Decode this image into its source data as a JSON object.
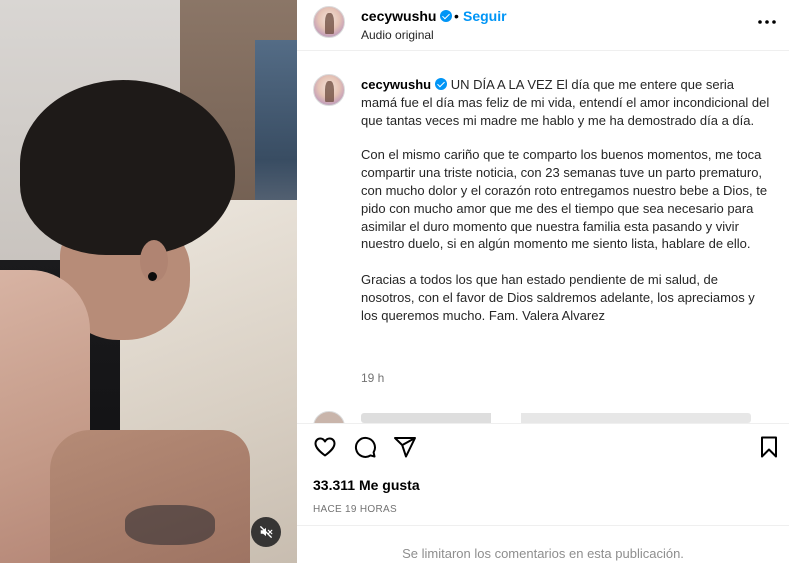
{
  "post": {
    "username": "cecywushu",
    "follow_label": "Seguir",
    "separator": "•",
    "audio": "Audio original",
    "more_icon": "more-horizontal-icon"
  },
  "caption": {
    "title": "UN DÍA A LA VEZ",
    "paragraphs": [
      "El día que me entere que seria mamá fue el día mas feliz de mi vida, entendí el amor incondicional del que tantas veces mi madre me hablo y me ha demostrado día a día.",
      "Con el mismo cariño que te comparto los buenos momentos, me toca compartir una triste noticia, con 23 semanas tuve un parto prematuro, con mucho dolor y el corazón roto entregamos nuestro bebe a Dios, te pido con mucho amor que me des el tiempo que sea necesario para asimilar el duro momento que nuestra familia esta pasando y vivir nuestro duelo, si en algún momento me siento lista, hablare de ello.",
      "Gracias a todos los que han estado pendiente de mi salud, de nosotros, con el favor de Dios saldremos adelante, los apreciamos y los queremos mucho. Fam. Valera Alvarez"
    ],
    "timestamp": "19 h"
  },
  "actions": {
    "like_icon": "heart-icon",
    "comment_icon": "comment-icon",
    "share_icon": "share-icon",
    "save_icon": "bookmark-icon"
  },
  "stats": {
    "likes": "33.311 Me gusta",
    "time_ago": "HACE 19 HORAS"
  },
  "footer": {
    "comments_disabled": "Se limitaron los comentarios en esta publicación."
  },
  "media": {
    "mute_icon": "speaker-muted-icon"
  },
  "colors": {
    "accent": "#0095f6",
    "text_secondary": "#737373",
    "border": "#efefef"
  }
}
